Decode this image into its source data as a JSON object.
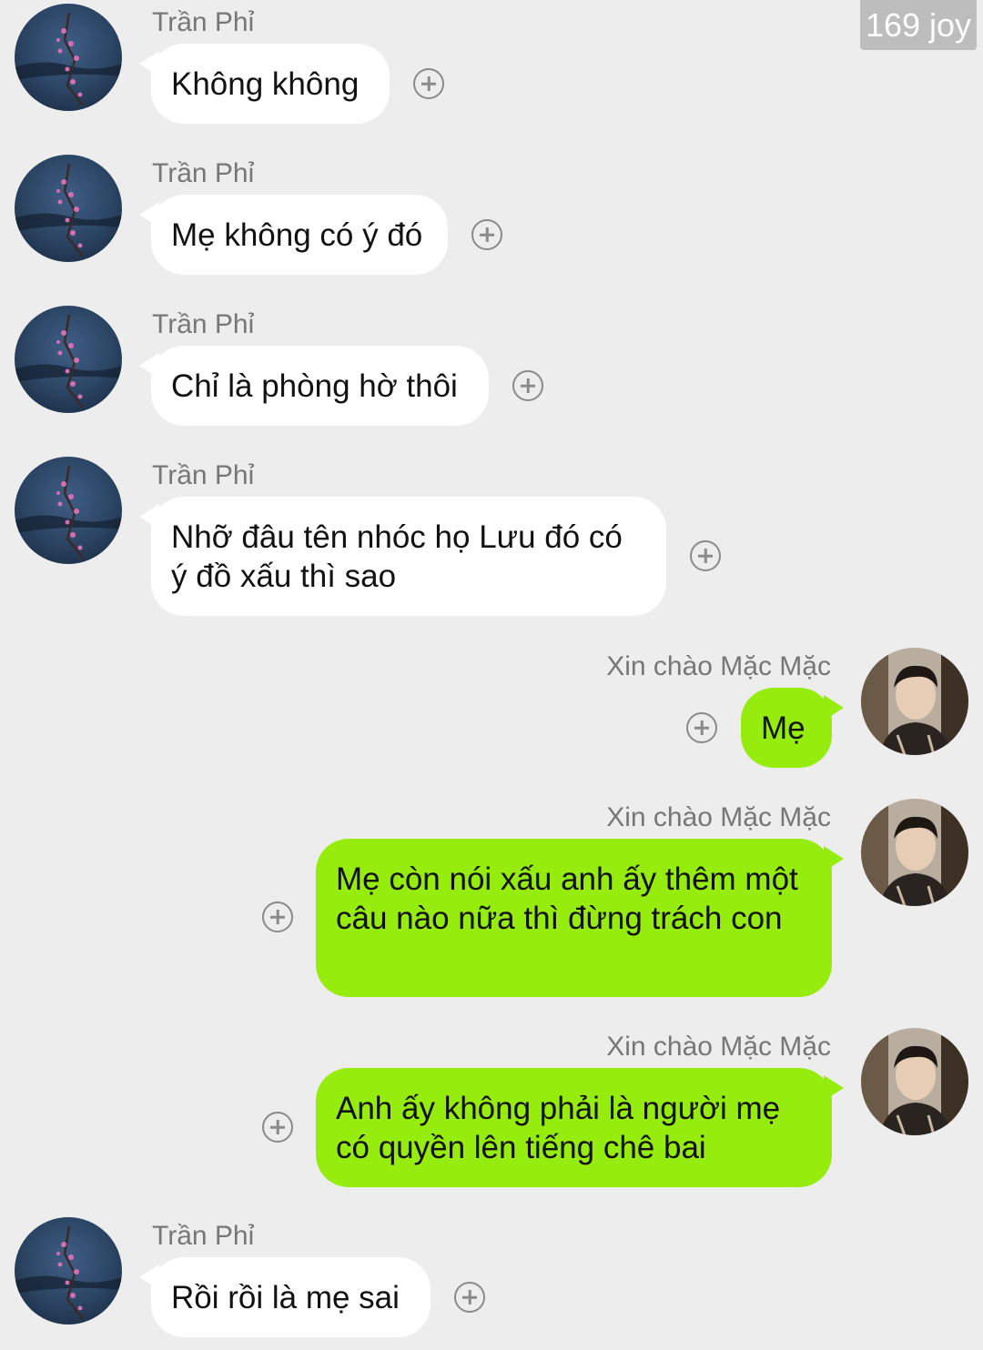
{
  "watermark": "169 joy",
  "contacts": {
    "mother": {
      "name": "Trần Phỉ",
      "avatar_icon": "plum-blossom-avatar-icon"
    },
    "me": {
      "name": "Xin chào Mặc Mặc",
      "avatar_icon": "portrait-avatar-icon"
    }
  },
  "colors": {
    "background": "#ededed",
    "incoming_bubble": "#ffffff",
    "outgoing_bubble": "#95ec0d"
  },
  "messages": [
    {
      "direction": "incoming",
      "sender": "Trần Phỉ",
      "text": "Không không"
    },
    {
      "direction": "incoming",
      "sender": "Trần Phỉ",
      "text": "Mẹ không có ý đó"
    },
    {
      "direction": "incoming",
      "sender": "Trần Phỉ",
      "text": "Chỉ là phòng hờ thôi"
    },
    {
      "direction": "incoming",
      "sender": "Trần Phỉ",
      "text": "Nhỡ đâu tên nhóc họ Lưu đó có ý đồ xấu thì sao"
    },
    {
      "direction": "outgoing",
      "sender": "Xin chào Mặc Mặc",
      "text": "Mẹ"
    },
    {
      "direction": "outgoing",
      "sender": "Xin chào Mặc Mặc",
      "text": "Mẹ còn nói xấu anh ấy thêm một câu nào nữa thì đừng trách con"
    },
    {
      "direction": "outgoing",
      "sender": "Xin chào Mặc Mặc",
      "text": "Anh ấy không phải là người mẹ có quyền lên tiếng chê bai"
    },
    {
      "direction": "incoming",
      "sender": "Trần Phỉ",
      "text": "Rồi rồi là mẹ sai"
    }
  ]
}
